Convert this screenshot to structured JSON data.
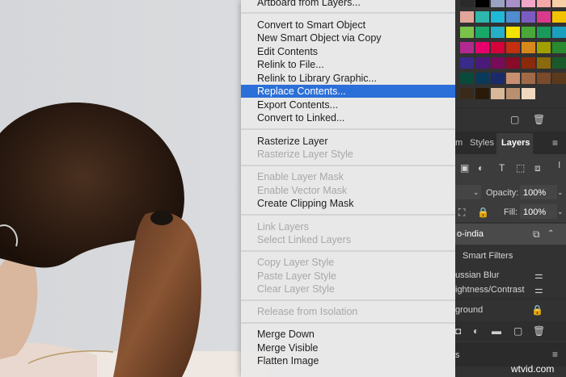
{
  "menu": {
    "items": [
      {
        "label": "Artboard from Layers...",
        "state": "enabled"
      },
      {
        "label": "Convert to Smart Object",
        "state": "enabled"
      },
      {
        "label": "New Smart Object via Copy",
        "state": "enabled"
      },
      {
        "label": "Edit Contents",
        "state": "enabled"
      },
      {
        "label": "Relink to File...",
        "state": "enabled"
      },
      {
        "label": "Relink to Library Graphic...",
        "state": "enabled"
      },
      {
        "label": "Replace Contents...",
        "state": "selected"
      },
      {
        "label": "Export Contents...",
        "state": "enabled"
      },
      {
        "label": "Convert to Linked...",
        "state": "enabled"
      },
      {
        "label": "Rasterize Layer",
        "state": "enabled"
      },
      {
        "label": "Rasterize Layer Style",
        "state": "disabled"
      },
      {
        "label": "Enable Layer Mask",
        "state": "disabled"
      },
      {
        "label": "Enable Vector Mask",
        "state": "disabled"
      },
      {
        "label": "Create Clipping Mask",
        "state": "enabled"
      },
      {
        "label": "Link Layers",
        "state": "disabled"
      },
      {
        "label": "Select Linked Layers",
        "state": "disabled"
      },
      {
        "label": "Copy Layer Style",
        "state": "disabled"
      },
      {
        "label": "Paste Layer Style",
        "state": "disabled"
      },
      {
        "label": "Clear Layer Style",
        "state": "disabled"
      },
      {
        "label": "Release from Isolation",
        "state": "disabled"
      },
      {
        "label": "Merge Down",
        "state": "enabled"
      },
      {
        "label": "Merge Visible",
        "state": "enabled"
      },
      {
        "label": "Flatten Image",
        "state": "enabled"
      }
    ]
  },
  "panels": {
    "tabs": {
      "partial": "m",
      "styles": "Styles",
      "layers": "Layers"
    },
    "opacity_label": "Opacity:",
    "opacity_value": "100%",
    "fill_label": "Fill:",
    "fill_value": "100%",
    "layers": [
      {
        "name": "o-india"
      },
      {
        "name": "Smart Filters"
      },
      {
        "name": "ussian Blur"
      },
      {
        "name": "ightness/Contrast"
      },
      {
        "name": "ground"
      }
    ]
  },
  "watermark": "wtvid.com",
  "colors": {
    "menu_highlight": "#2b6fd8",
    "panel_bg": "#323232",
    "menu_bg": "#e9e8e8"
  }
}
